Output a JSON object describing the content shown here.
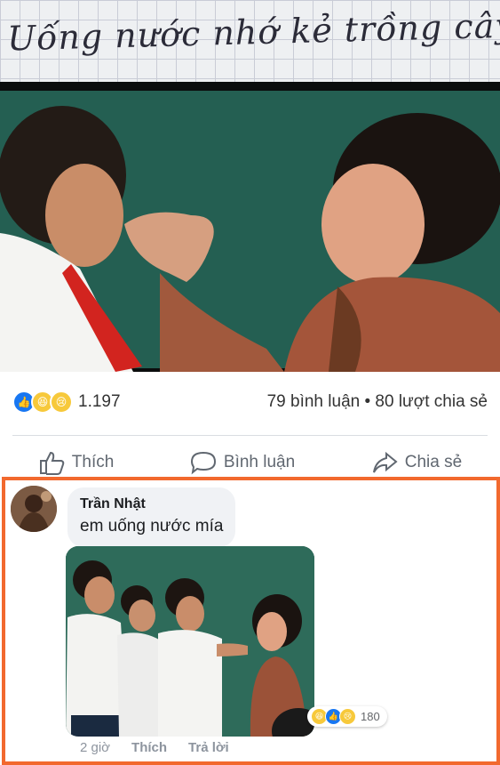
{
  "header": {
    "handwriting": "Uống nước nhớ kẻ trồng cây"
  },
  "post": {
    "reaction_icons": [
      "like-icon",
      "haha-icon",
      "sad-icon"
    ],
    "reaction_count": "1.197",
    "comments_count": "79 bình luận",
    "separator": "•",
    "shares_count": "80 lượt chia sẻ"
  },
  "actions": {
    "like": "Thích",
    "comment": "Bình luận",
    "share": "Chia sẻ"
  },
  "comment": {
    "author": "Trần Nhật",
    "text": "em uống nước mía",
    "reactions_count": "180",
    "reaction_icons": [
      "haha-icon",
      "like-icon",
      "sad-icon"
    ],
    "time": "2 giờ",
    "like": "Thích",
    "reply": "Trả lời"
  },
  "colors": {
    "highlight": "#f2692e",
    "fb_blue": "#1877f2",
    "meta_gray": "#8d949e"
  }
}
